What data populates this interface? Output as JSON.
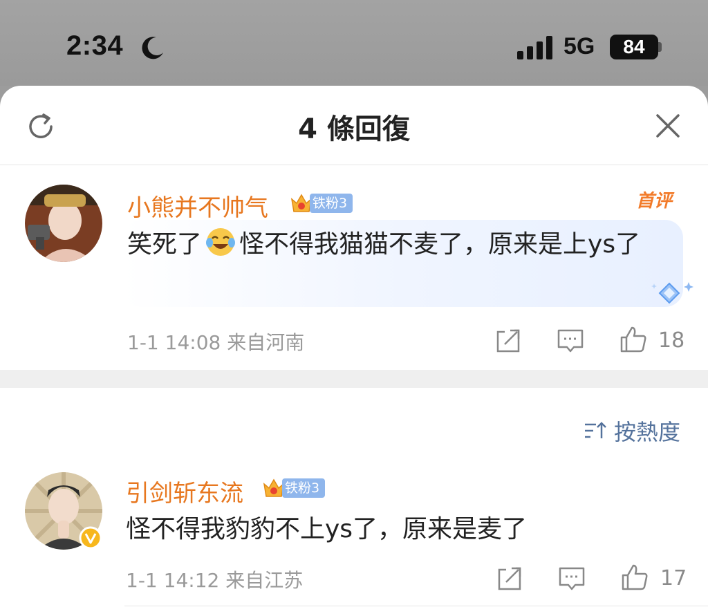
{
  "status_bar": {
    "time": "2:34",
    "network": "5G",
    "battery": "84"
  },
  "sheet": {
    "title": "4 條回復"
  },
  "comments": [
    {
      "username": "小熊并不帅气",
      "fan_level": "铁粉3",
      "text_before_emoji": "笑死了",
      "text_after_emoji": "怪不得我猫猫不麦了，原来是上ys了",
      "time": "1-1 14:08",
      "location": "来自河南",
      "likes": "18",
      "badge": "首评"
    },
    {
      "username": "引剑斩东流",
      "fan_level": "铁粉3",
      "text": "怪不得我豹豹不上ys了，原来是麦了",
      "time": "1-1 14:12",
      "location": "来自江苏",
      "likes": "17"
    }
  ],
  "sort": {
    "label": "按熱度"
  },
  "colors": {
    "username": "#e7771f",
    "fan_badge": "#8fb6ec",
    "sort_label": "#54729c",
    "first_badge": "#f27b2a"
  },
  "icons": [
    "moon-icon",
    "signal-icon",
    "refresh-icon",
    "close-icon",
    "crown-icon",
    "laughing-emoji-icon",
    "share-icon",
    "comment-icon",
    "like-icon",
    "sort-icon",
    "verified-icon"
  ]
}
